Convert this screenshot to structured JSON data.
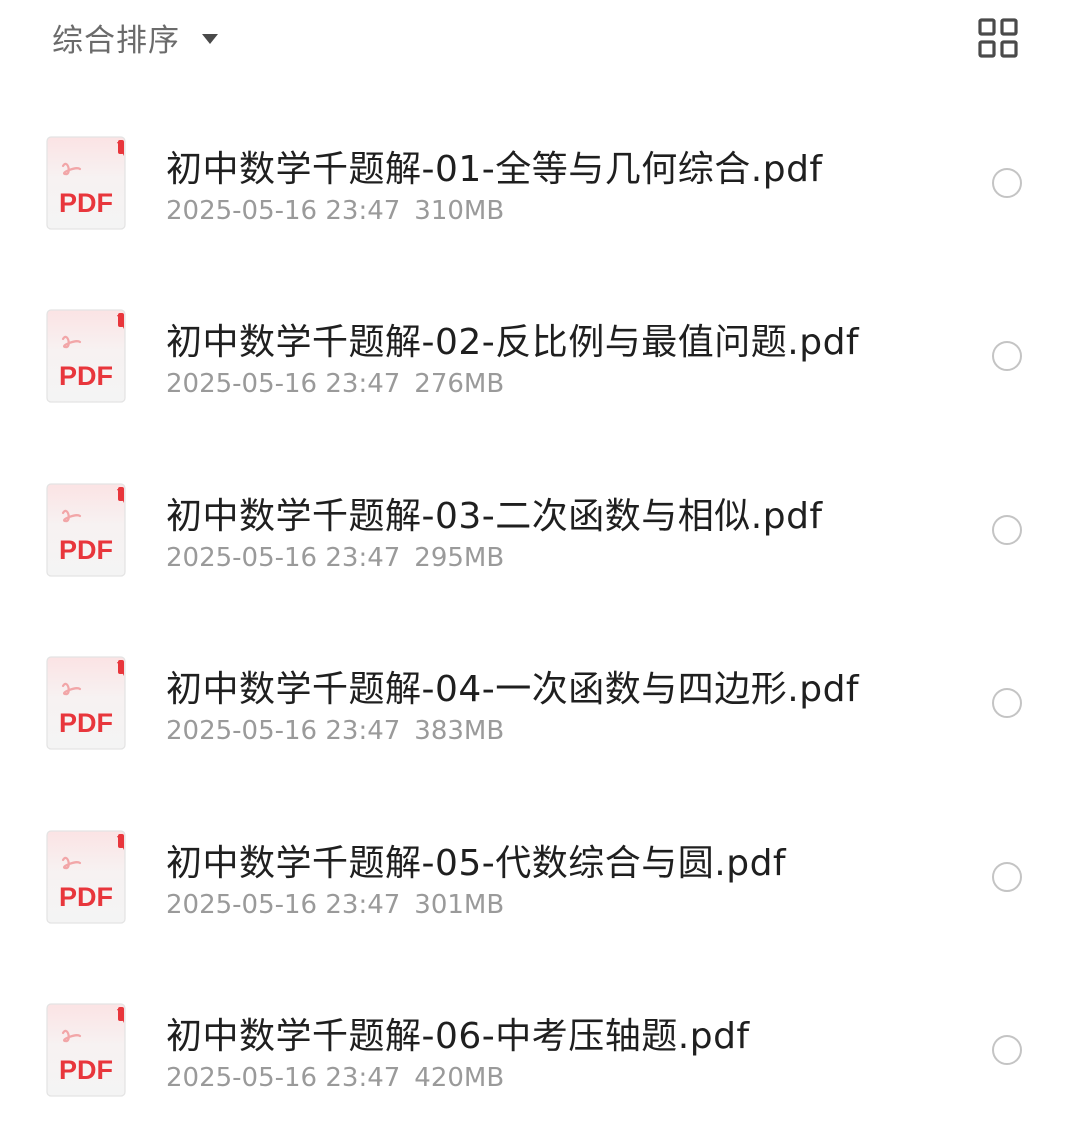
{
  "toolbar": {
    "sort_label": "综合排序",
    "sort_icon": "caret-down-icon",
    "view_toggle_icon": "grid-view-icon"
  },
  "colors": {
    "pdf_red": "#e8363c",
    "text_primary": "#1f1f1f",
    "text_secondary": "#9a9a9a",
    "radio_border": "#c4c4c4"
  },
  "files": [
    {
      "icon_text": "PDF",
      "name": "初中数学千题解-01-全等与几何综合.pdf",
      "date": "2025-05-16 23:47",
      "size": "310MB",
      "selected": false
    },
    {
      "icon_text": "PDF",
      "name": "初中数学千题解-02-反比例与最值问题.pdf",
      "date": "2025-05-16 23:47",
      "size": "276MB",
      "selected": false
    },
    {
      "icon_text": "PDF",
      "name": "初中数学千题解-03-二次函数与相似.pdf",
      "date": "2025-05-16 23:47",
      "size": "295MB",
      "selected": false
    },
    {
      "icon_text": "PDF",
      "name": "初中数学千题解-04-一次函数与四边形.pdf",
      "date": "2025-05-16 23:47",
      "size": "383MB",
      "selected": false
    },
    {
      "icon_text": "PDF",
      "name": "初中数学千题解-05-代数综合与圆.pdf",
      "date": "2025-05-16 23:47",
      "size": "301MB",
      "selected": false
    },
    {
      "icon_text": "PDF",
      "name": "初中数学千题解-06-中考压轴题.pdf",
      "date": "2025-05-16 23:47",
      "size": "420MB",
      "selected": false
    }
  ]
}
